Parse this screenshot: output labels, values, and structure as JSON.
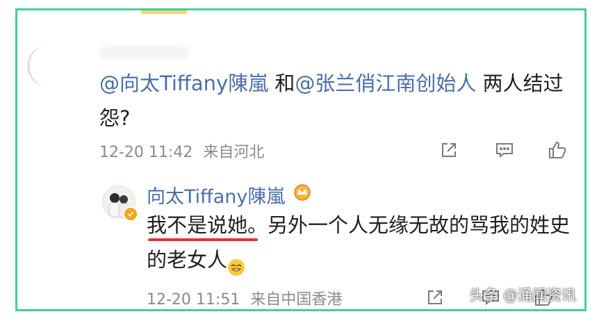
{
  "comment": {
    "mention1": "@向太Tiffany陳嵐",
    "connector": " 和",
    "mention2": "@张兰俏江南创始人",
    "rest": " 两人结过怨?",
    "time": "12-20 11:42",
    "location": "来自河北",
    "actions": [
      "share-icon",
      "comment-icon",
      "like-icon"
    ]
  },
  "reply": {
    "author": "向太Tiffany陳嵐",
    "text_underlined": "我不是说她",
    "text_rest": "。另外一个人无缘无故的骂我的姓史的老女人",
    "time": "12-20 11:51",
    "location": "来自中国香港",
    "actions": [
      "share-icon",
      "comment-icon",
      "like-icon"
    ]
  },
  "colors": {
    "border": "#3fcf9a",
    "mention": "#4a6ea8",
    "underline": "#e0303a",
    "meta": "#8a8a8a"
  },
  "watermark": "头条 @涌闻资讯"
}
